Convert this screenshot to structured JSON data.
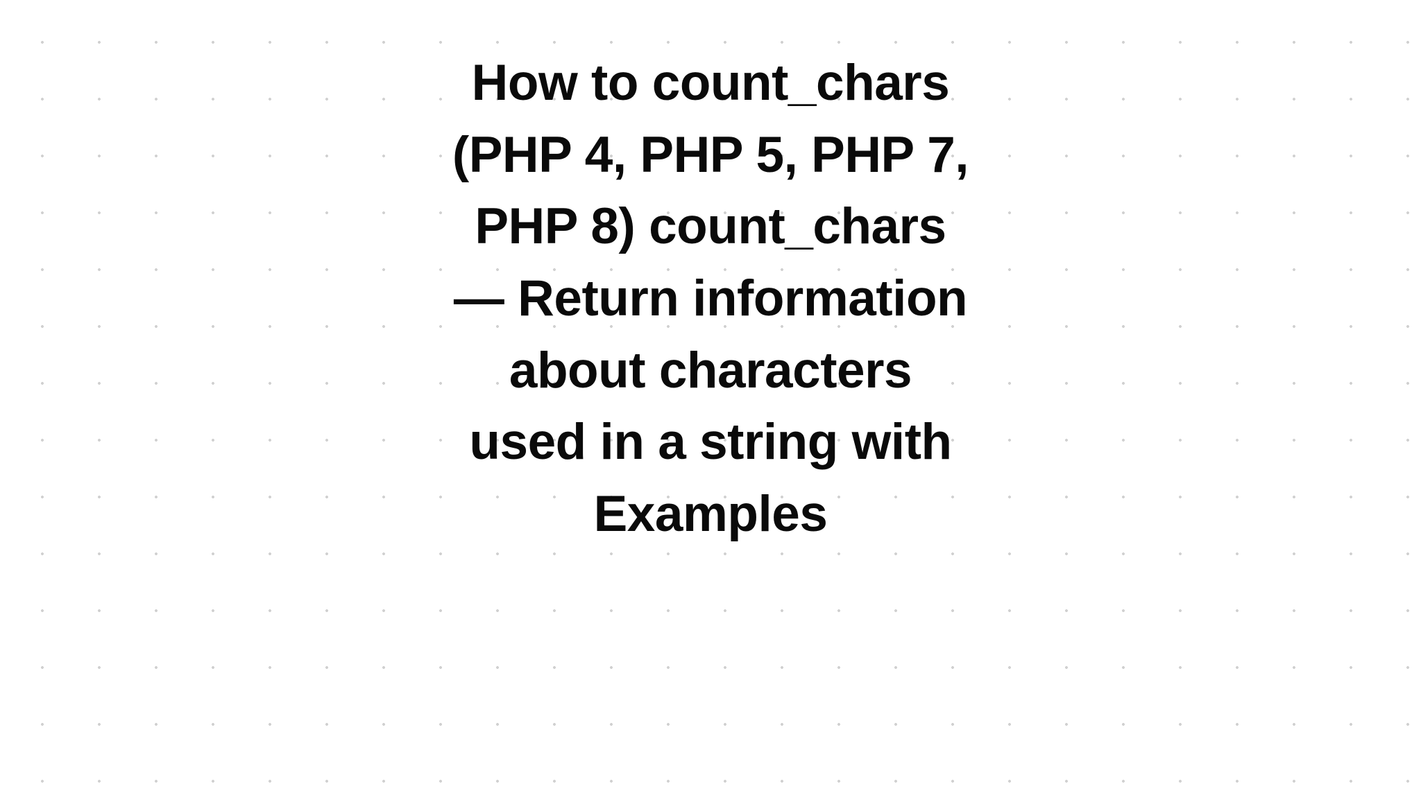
{
  "heading": "How to count_chars (PHP 4, PHP 5, PHP 7, PHP 8) count_chars — Return information about characters used in a string with Examples"
}
